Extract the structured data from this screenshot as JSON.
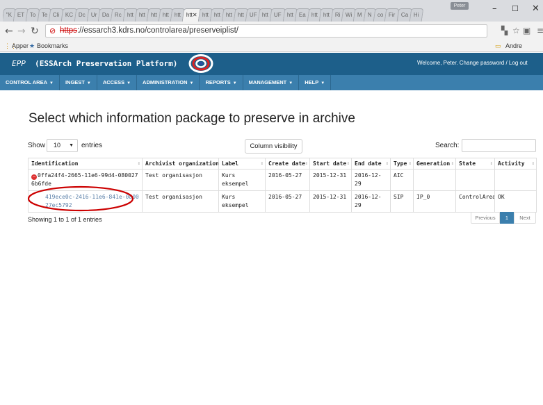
{
  "browser": {
    "tabs": [
      "\"K",
      "ET",
      "To",
      "Te",
      "Cli",
      "KC",
      "Dc",
      "Ur",
      "Da",
      "Rc",
      "htt",
      "htt",
      "htt",
      "htt",
      "htt",
      "htt",
      "htt",
      "htt",
      "htt",
      "htt",
      "UF",
      "htt",
      "UF",
      "htt",
      "Ea",
      "htt",
      "htt",
      "Ri",
      "Wi",
      "M",
      "N",
      "co",
      "Fir",
      "Ca",
      "Hi"
    ],
    "active_tab_index": 15,
    "user_badge": "Peter",
    "url_scheme": "https",
    "url_rest": "://essarch3.kdrs.no/controlarea/preserveiplist/",
    "bookmarks_apps": "Apper",
    "bookmarks_label": "Bookmarks",
    "other_bookmarks": "Andre bokmerker"
  },
  "app": {
    "title_prefix": "EPP",
    "title": "(ESSArch Preservation Platform)",
    "welcome": "Welcome, Peter. Change password / Log out",
    "nav": [
      {
        "label": "CONTROL AREA"
      },
      {
        "label": "INGEST"
      },
      {
        "label": "ACCESS"
      },
      {
        "label": "ADMINISTRATION"
      },
      {
        "label": "REPORTS"
      },
      {
        "label": "MANAGEMENT"
      },
      {
        "label": "HELP"
      }
    ]
  },
  "page": {
    "title": "Select which information package to preserve in archive",
    "show_label": "Show",
    "entries_value": "10",
    "entries_label": "entries",
    "column_visibility": "Column visibility",
    "search_label": "Search:",
    "search_value": "",
    "info": "Showing 1 to 1 of 1 entries",
    "pager": {
      "previous": "Previous",
      "current": "1",
      "next": "Next"
    }
  },
  "table": {
    "columns": [
      "Identification",
      "Archivist organization",
      "Label",
      "Create date",
      "Start date",
      "End date",
      "Type",
      "Generation",
      "State",
      "Activity"
    ],
    "rows": [
      {
        "id": "0ffa24f4-2665-11e6-99d4-0800276b6fde",
        "org": "Test organisasjon",
        "label": "Kurs eksempel",
        "create": "2016-05-27",
        "start": "2015-12-31",
        "end": "2016-12-29",
        "type": "AIC",
        "generation": "",
        "state": "",
        "activity": "",
        "error": true
      },
      {
        "id": "419ece0c-2416-11e6-841e-080027ec5792",
        "org": "Test organisasjon",
        "label": "Kurs eksempel",
        "create": "2016-05-27",
        "start": "2015-12-31",
        "end": "2016-12-29",
        "type": "SIP",
        "generation": "IP_0",
        "state": "ControlArea",
        "activity": "OK",
        "error": false
      }
    ]
  },
  "colors": {
    "header": "#1d5f8a",
    "navbar": "#3b7fad",
    "annotation": "#cc0000"
  }
}
